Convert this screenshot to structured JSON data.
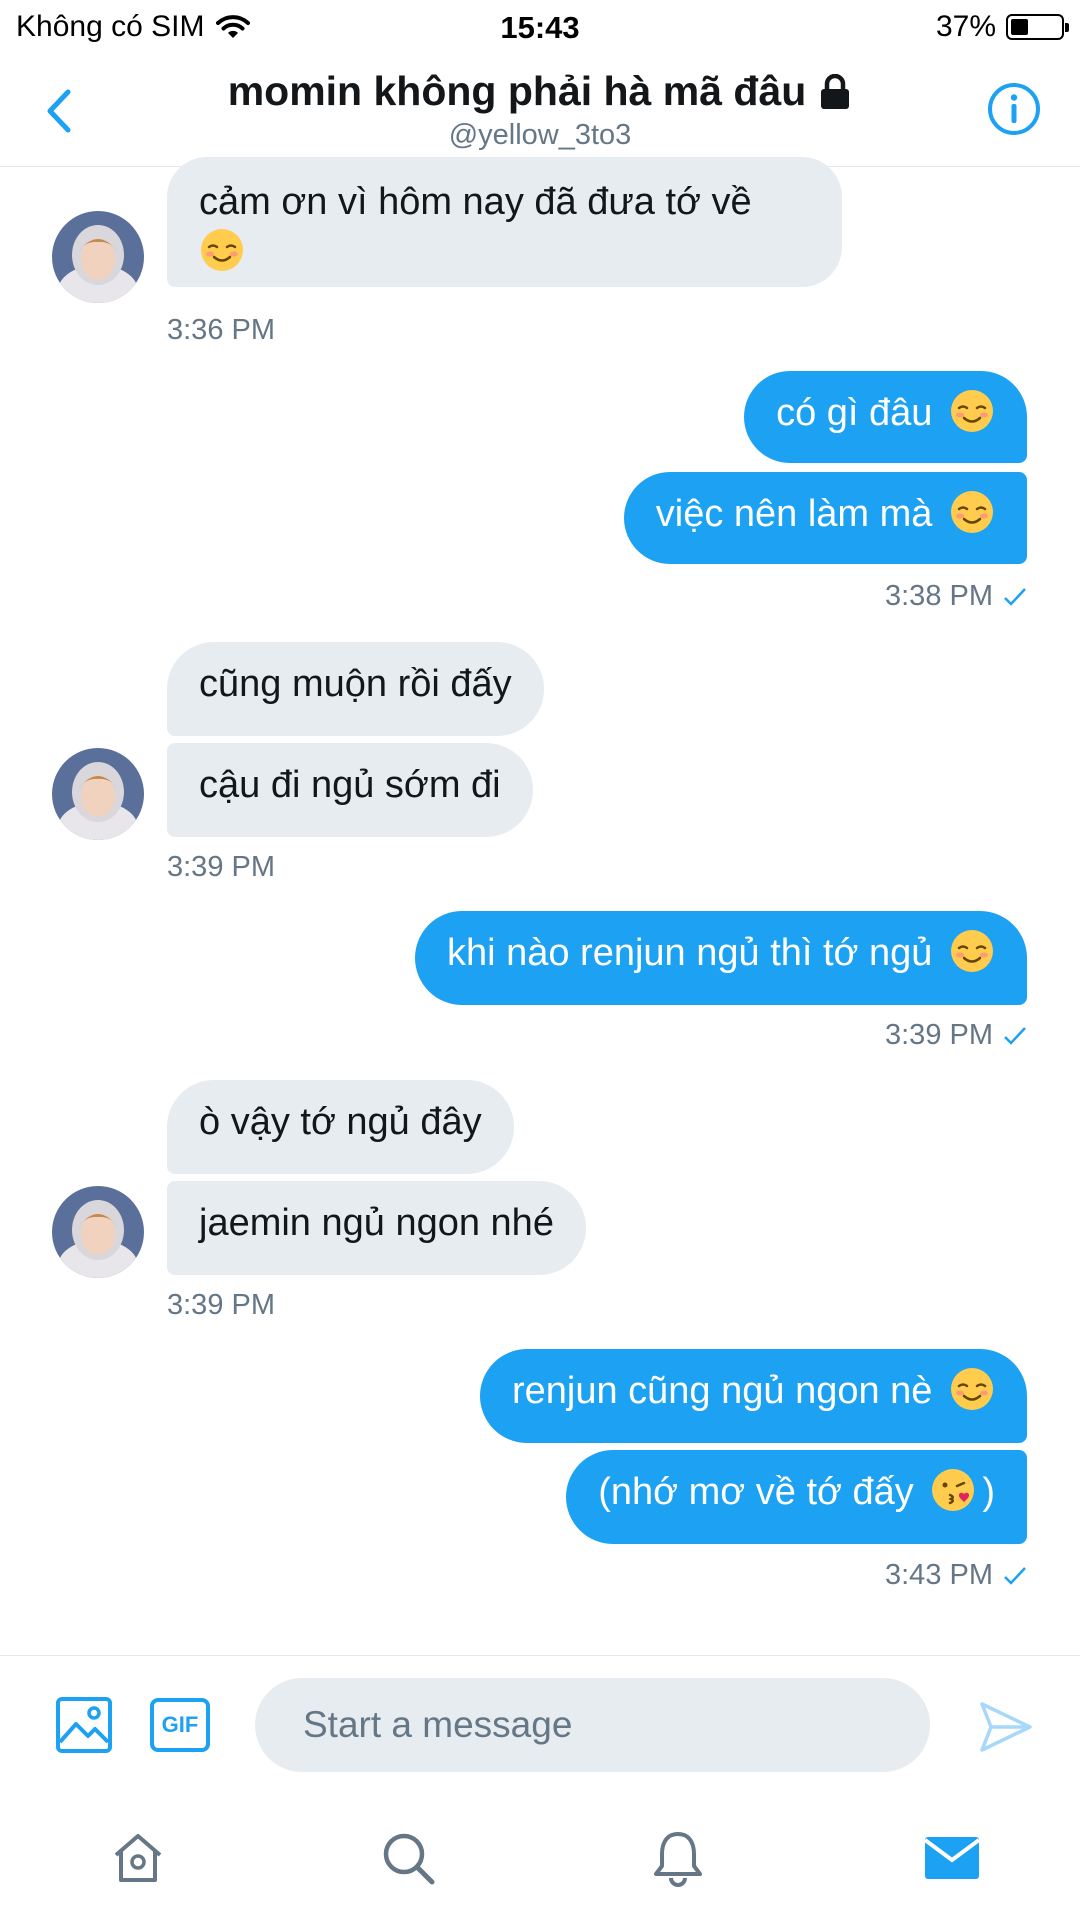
{
  "status_bar": {
    "carrier": "Không có SIM",
    "time": "15:43",
    "battery": "37%",
    "battery_level": 0.37
  },
  "header": {
    "title": "momin không phải hà mã đâu",
    "handle": "@yellow_3to3"
  },
  "messages": [
    {
      "lines": [
        "cảm ơn vì hôm nay đã đưa tớ về"
      ],
      "emoji": "smiling-face-icon"
    },
    {
      "text": "có gì đâu",
      "emoji": "smiling-face-icon"
    },
    {
      "text": "việc nên làm mà",
      "emoji": "smiling-face-icon"
    },
    {
      "text": "cũng muộn rồi đấy"
    },
    {
      "text": "cậu đi ngủ sớm đi"
    },
    {
      "text": "khi nào renjun ngủ thì tớ ngủ",
      "emoji": "smiling-face-icon"
    },
    {
      "text": "ò vậy tớ ngủ đây"
    },
    {
      "text": "jaemin ngủ ngon nhé"
    },
    {
      "text": "renjun cũng ngủ ngon nè",
      "emoji": "smiling-face-icon"
    },
    {
      "text_before": "(nhớ mơ về tớ đấy",
      "text_after": ")",
      "emoji": "kissing-face-icon"
    }
  ],
  "timestamps": [
    "3:36 PM",
    "3:38 PM",
    "3:39 PM",
    "3:39 PM",
    "3:39 PM",
    "3:43 PM"
  ],
  "composer": {
    "placeholder": "Start a message",
    "gif_label": "GIF"
  },
  "colors": {
    "accent": "#1da1f2",
    "incoming_bubble": "#e6ecf0",
    "secondary_text": "#657786"
  }
}
